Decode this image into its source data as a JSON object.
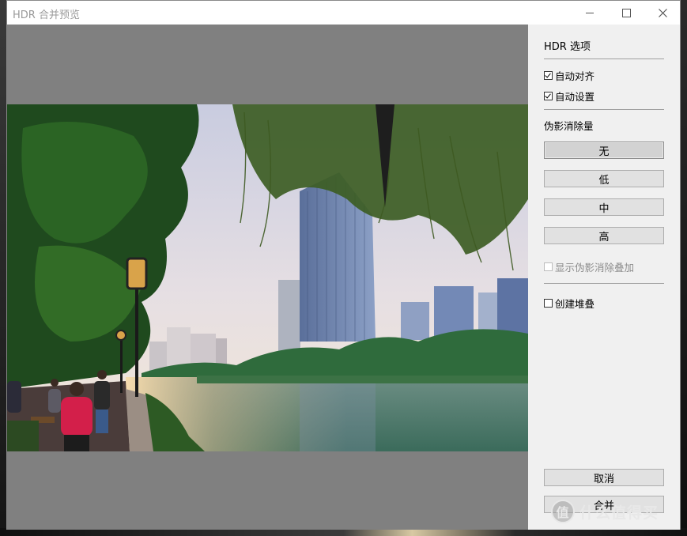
{
  "window": {
    "title": "HDR 合并预览"
  },
  "options": {
    "title": "HDR 选项",
    "auto_align": {
      "label": "自动对齐",
      "checked": true
    },
    "auto_settings": {
      "label": "自动设置",
      "checked": true
    },
    "deghost_label": "伪影消除量",
    "deghost_levels": [
      {
        "label": "无",
        "selected": true
      },
      {
        "label": "低",
        "selected": false
      },
      {
        "label": "中",
        "selected": false
      },
      {
        "label": "高",
        "selected": false
      }
    ],
    "show_overlay": {
      "label": "显示伪影消除叠加",
      "checked": false,
      "enabled": false
    },
    "create_stack": {
      "label": "创建堆叠",
      "checked": false
    }
  },
  "actions": {
    "cancel": "取消",
    "merge": "合并"
  },
  "watermark": {
    "glyph": "值",
    "text": "什么值得买"
  },
  "icons": {
    "minimize": "minimize-icon",
    "maximize": "maximize-icon",
    "close": "close-icon"
  }
}
